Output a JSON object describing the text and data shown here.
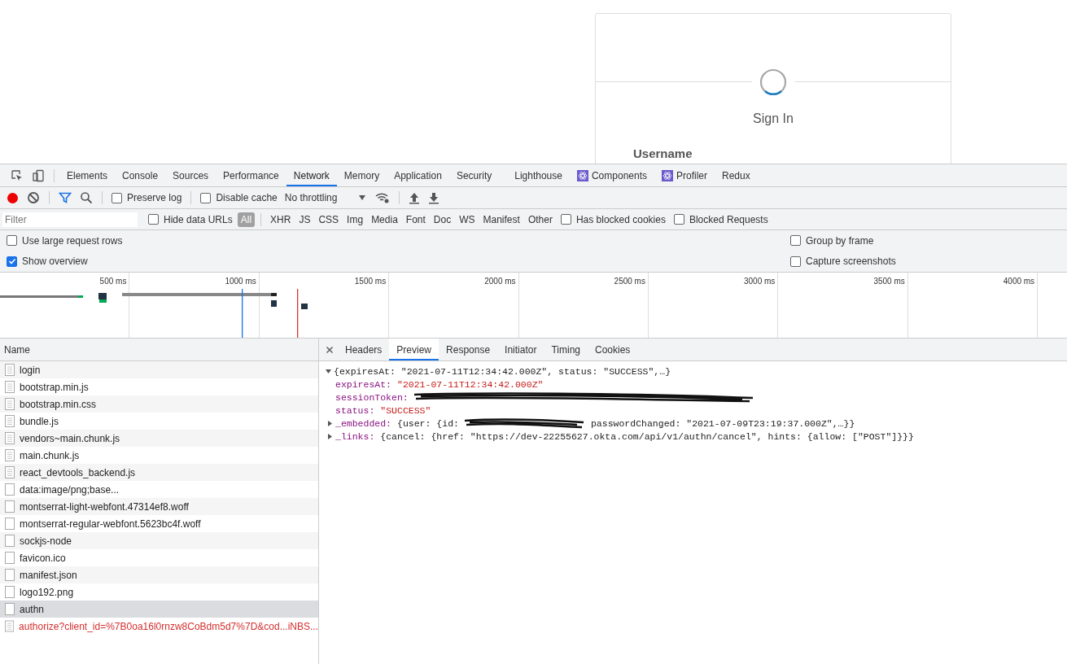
{
  "signin": {
    "title": "Sign In",
    "username_label": "Username"
  },
  "devtools": {
    "tabs": [
      {
        "label": "Elements",
        "kind": "plain",
        "selected": false
      },
      {
        "label": "Console",
        "kind": "plain",
        "selected": false
      },
      {
        "label": "Sources",
        "kind": "plain",
        "selected": false
      },
      {
        "label": "Performance",
        "kind": "plain",
        "selected": false
      },
      {
        "label": "Network",
        "kind": "plain",
        "selected": true
      },
      {
        "label": "Memory",
        "kind": "plain",
        "selected": false
      },
      {
        "label": "Application",
        "kind": "plain",
        "selected": false
      },
      {
        "label": "Security",
        "kind": "plain",
        "selected": false
      },
      {
        "label": "Lighthouse",
        "kind": "plain",
        "selected": false
      },
      {
        "label": "Components",
        "kind": "react",
        "selected": false
      },
      {
        "label": "Profiler",
        "kind": "react",
        "selected": false
      },
      {
        "label": "Redux",
        "kind": "plain",
        "selected": false
      }
    ],
    "toolbar": {
      "recording": true,
      "preserve_log": {
        "label": "Preserve log",
        "checked": false
      },
      "disable_cache": {
        "label": "Disable cache",
        "checked": false
      },
      "throttling": "No throttling"
    },
    "filter_bar": {
      "placeholder": "Filter",
      "hide_data_urls": {
        "label": "Hide data URLs",
        "checked": false
      },
      "types": [
        {
          "label": "All",
          "selected": true
        },
        {
          "label": "XHR",
          "selected": false
        },
        {
          "label": "JS",
          "selected": false
        },
        {
          "label": "CSS",
          "selected": false
        },
        {
          "label": "Img",
          "selected": false
        },
        {
          "label": "Media",
          "selected": false
        },
        {
          "label": "Font",
          "selected": false
        },
        {
          "label": "Doc",
          "selected": false
        },
        {
          "label": "WS",
          "selected": false
        },
        {
          "label": "Manifest",
          "selected": false
        },
        {
          "label": "Other",
          "selected": false
        }
      ],
      "has_blocked_cookies": {
        "label": "Has blocked cookies",
        "checked": false
      },
      "blocked_requests": {
        "label": "Blocked Requests",
        "checked": false
      }
    },
    "options_left": [
      {
        "label": "Use large request rows",
        "checked": false
      },
      {
        "label": "Show overview",
        "checked": true
      }
    ],
    "options_right": [
      {
        "label": "Group by frame",
        "checked": false
      },
      {
        "label": "Capture screenshots",
        "checked": false
      }
    ],
    "overview_ticks": [
      "500 ms",
      "1000 ms",
      "1500 ms",
      "2000 ms",
      "2500 ms",
      "3000 ms",
      "3500 ms",
      "4000 ms"
    ],
    "requests": {
      "column": "Name",
      "rows": [
        {
          "name": "login",
          "kind": "doc",
          "selected": false,
          "error": false
        },
        {
          "name": "bootstrap.min.js",
          "kind": "doc",
          "selected": false,
          "error": false
        },
        {
          "name": "bootstrap.min.css",
          "kind": "doc",
          "selected": false,
          "error": false
        },
        {
          "name": "bundle.js",
          "kind": "doc",
          "selected": false,
          "error": false
        },
        {
          "name": "vendors~main.chunk.js",
          "kind": "doc",
          "selected": false,
          "error": false
        },
        {
          "name": "main.chunk.js",
          "kind": "doc",
          "selected": false,
          "error": false
        },
        {
          "name": "react_devtools_backend.js",
          "kind": "doc",
          "selected": false,
          "error": false
        },
        {
          "name": "data:image/png;base...",
          "kind": "blank",
          "selected": false,
          "error": false
        },
        {
          "name": "montserrat-light-webfont.47314ef8.woff",
          "kind": "blank",
          "selected": false,
          "error": false
        },
        {
          "name": "montserrat-regular-webfont.5623bc4f.woff",
          "kind": "blank",
          "selected": false,
          "error": false
        },
        {
          "name": "sockjs-node",
          "kind": "blank",
          "selected": false,
          "error": false
        },
        {
          "name": "favicon.ico",
          "kind": "blank",
          "selected": false,
          "error": false
        },
        {
          "name": "manifest.json",
          "kind": "blank",
          "selected": false,
          "error": false
        },
        {
          "name": "logo192.png",
          "kind": "blank",
          "selected": false,
          "error": false
        },
        {
          "name": "authn",
          "kind": "blank",
          "selected": true,
          "error": false
        },
        {
          "name": "authorize?client_id=%7B0oa16l0rnzw8CoBdm5d7%7D&cod...iNBS...",
          "kind": "doc",
          "selected": false,
          "error": true
        }
      ]
    },
    "detail_tabs": [
      {
        "label": "Headers",
        "selected": false
      },
      {
        "label": "Preview",
        "selected": true
      },
      {
        "label": "Response",
        "selected": false
      },
      {
        "label": "Initiator",
        "selected": false
      },
      {
        "label": "Timing",
        "selected": false
      },
      {
        "label": "Cookies",
        "selected": false
      }
    ],
    "preview": {
      "summary": "{expiresAt: \"2021-07-11T12:34:42.000Z\", status: \"SUCCESS\",…}",
      "expanded": true,
      "fields": [
        {
          "key": "expiresAt:",
          "kind": "string",
          "value": "\"2021-07-11T12:34:42.000Z\""
        },
        {
          "key": "sessionToken:",
          "kind": "redacted"
        },
        {
          "key": "status:",
          "kind": "string",
          "value": "\"SUCCESS\""
        },
        {
          "key": "_embedded:",
          "kind": "object",
          "expanded": false,
          "value": "{user: {id:",
          "value_after": "passwordChanged: \"2021-07-09T23:19:37.000Z\",…}}"
        },
        {
          "key": "_links:",
          "kind": "object",
          "expanded": false,
          "value": "{cancel: {href: \"https://dev-22255627.okta.com/api/v1/authn/cancel\", hints: {allow: [\"POST\"]}}}"
        }
      ]
    }
  }
}
